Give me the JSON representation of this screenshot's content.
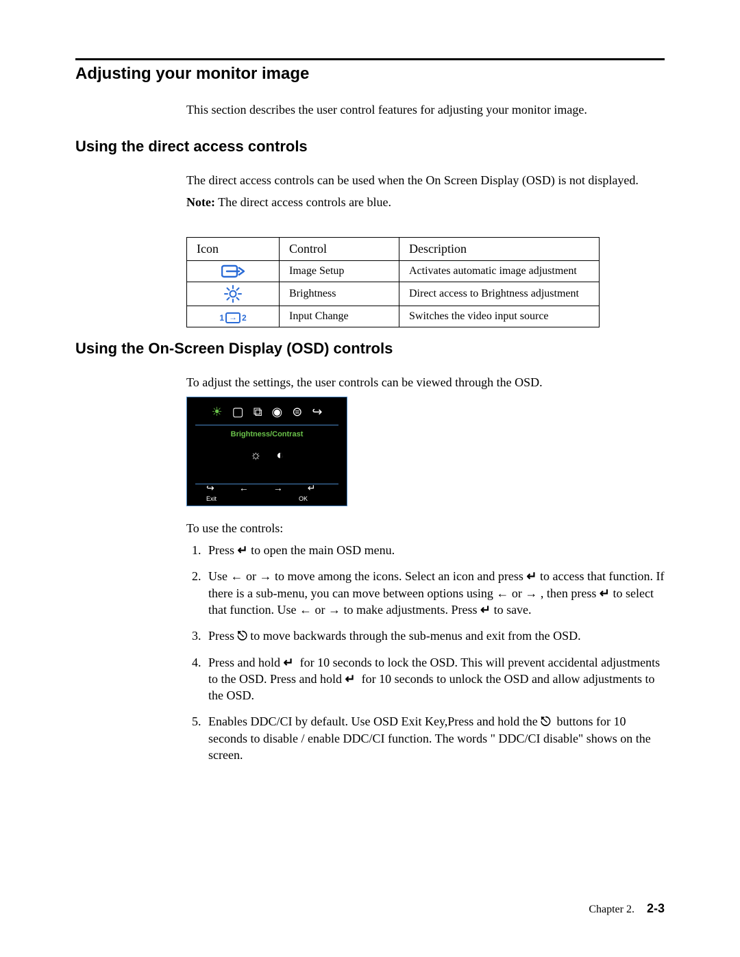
{
  "headings": {
    "h2": "Adjusting your monitor image",
    "h3a": "Using the direct access controls",
    "h3b": "Using the On-Screen Display (OSD) controls"
  },
  "intro": "This section describes the user control features for adjusting your monitor image.",
  "direct_access": {
    "p1": "The direct access controls can be used when the On Screen Display (OSD) is not displayed.",
    "note_label": "Note:",
    "note_text": " The direct access controls are blue."
  },
  "table": {
    "headers": {
      "icon": "Icon",
      "control": "Control",
      "description": "Description"
    },
    "rows": [
      {
        "icon_name": "image-setup-icon",
        "control": "Image Setup",
        "description": "Activates automatic image adjustment"
      },
      {
        "icon_name": "brightness-icon",
        "control": "Brightness",
        "description": "Direct access to Brightness adjustment"
      },
      {
        "icon_name": "input-change-icon",
        "control": "Input Change",
        "description": "Switches the video input source"
      }
    ],
    "input_change_labels": {
      "left": "1",
      "right": "2"
    }
  },
  "osd": {
    "intro": "To adjust the settings, the user controls can be viewed through the OSD.",
    "title": "Brightness/Contrast",
    "bottom_labels": {
      "exit": "Exit",
      "ok": "OK"
    },
    "to_use": "To use the controls:"
  },
  "steps": {
    "s1_a": "Press ",
    "s1_b": " to open the main OSD menu.",
    "s2_a": "Use ",
    "s2_b": " or ",
    "s2_c": " to move among the icons. Select an icon and press ",
    "s2_d": " to access that function. If there is a sub-menu, you can move between options using ",
    "s2_e": " or ",
    "s2_f": " , then press ",
    "s2_g": " to select that function. Use ",
    "s2_h": " or ",
    "s2_i": " to make adjustments. Press ",
    "s2_j": " to save.",
    "s3_a": "Press ",
    "s3_b": "   to move backwards through the sub-menus and exit from the OSD.",
    "s4_a": "Press and hold ",
    "s4_b": " for 10 seconds to lock the OSD. This will prevent accidental adjustments to the OSD. Press and hold ",
    "s4_c": " for 10  seconds to unlock the OSD and allow adjustments to the OSD.",
    "s5": "Enables DDC/CI by default. Use OSD Exit Key,Press and hold the ",
    "s5_b": " buttons for 10 seconds to disable / enable DDC/CI function. The words \" DDC/CI disable\" shows on the screen."
  },
  "glyphs": {
    "enter": "↵",
    "left": "←",
    "right": "→",
    "exit": "⎋"
  },
  "footer": {
    "chapter": "Chapter 2.",
    "page": "2-3"
  }
}
